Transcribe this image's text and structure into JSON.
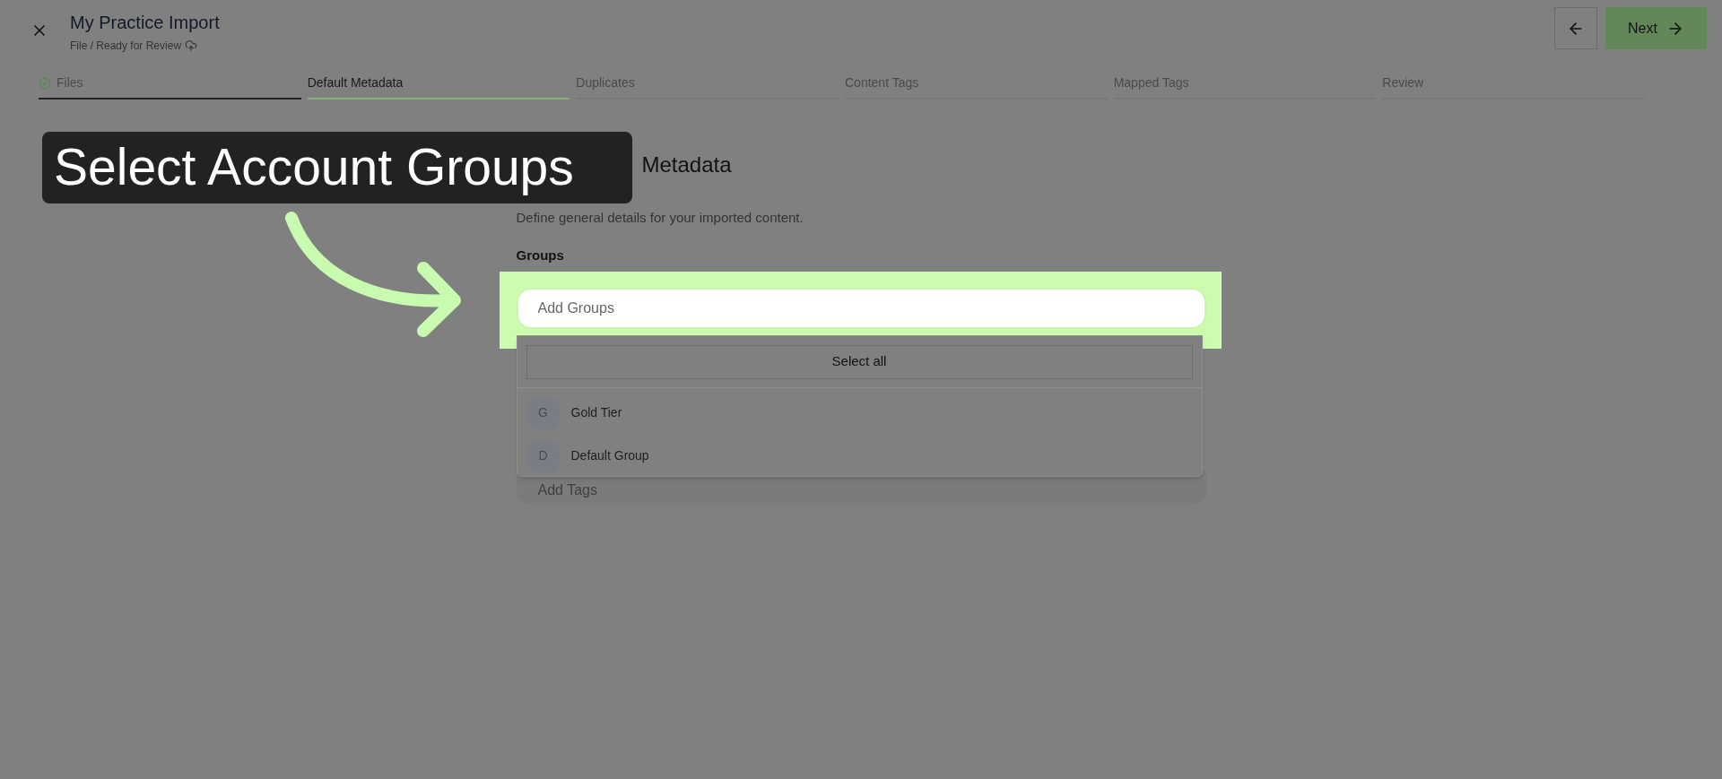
{
  "header": {
    "title": "My Practice Import",
    "breadcrumb": "File / Ready for Review",
    "next_label": "Next"
  },
  "steps": [
    {
      "label": "Files",
      "selected": false,
      "done": true
    },
    {
      "label": "Default Metadata",
      "selected": true,
      "done": false
    },
    {
      "label": "Duplicates",
      "selected": false,
      "done": false
    },
    {
      "label": "Content Tags",
      "selected": false,
      "done": false
    },
    {
      "label": "Mapped Tags",
      "selected": false,
      "done": false
    },
    {
      "label": "Review",
      "selected": false,
      "done": false
    }
  ],
  "section": {
    "heading_visible": "Metadata",
    "subtitle": "Define general details for your imported content."
  },
  "groups_field": {
    "label": "Groups",
    "placeholder": "Add Groups"
  },
  "dropdown": {
    "select_all": "Select all",
    "options": [
      {
        "initial": "G",
        "name": "Gold Tier"
      },
      {
        "initial": "D",
        "name": "Default Group"
      }
    ]
  },
  "tags_field": {
    "placeholder": "Add Tags"
  },
  "callout": {
    "text": "Select Account Groups"
  }
}
